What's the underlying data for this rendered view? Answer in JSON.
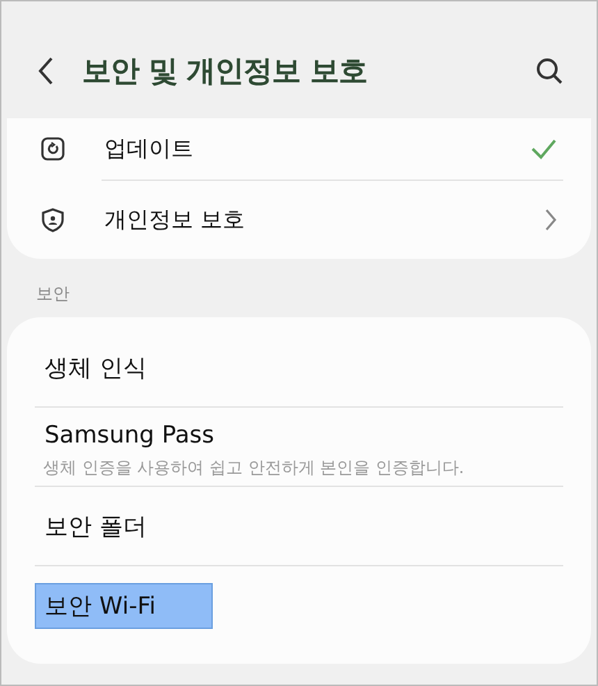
{
  "header": {
    "title": "보안 및 개인정보 보호"
  },
  "top_card": {
    "items": [
      {
        "label": "업데이트",
        "kind": "check"
      },
      {
        "label": "개인정보 보호",
        "kind": "chevron"
      }
    ]
  },
  "section": {
    "label": "보안",
    "items": [
      {
        "label": "생체 인식",
        "highlighted": false
      },
      {
        "label": "Samsung Pass",
        "subtitle": "생체 인증을 사용하여 쉽고 안전하게 본인을 인증합니다.",
        "highlighted": false
      },
      {
        "label": "보안 폴더",
        "highlighted": false
      },
      {
        "label": "보안 Wi-Fi",
        "highlighted": true
      }
    ]
  }
}
